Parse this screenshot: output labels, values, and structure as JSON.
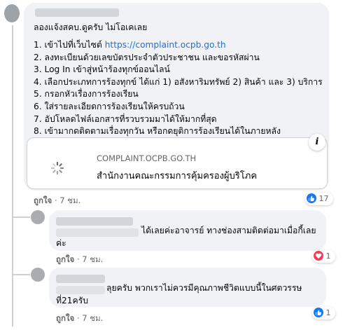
{
  "comment": {
    "author": "",
    "intro": "ลองแจ้งสคบ.ดูครับ ไม่โอเคเลย",
    "steps": [
      {
        "num": "1.",
        "text": "เข้าไปที่เว็บไซต์ ",
        "link": "https://complaint.ocpb.go.th"
      },
      {
        "num": "2.",
        "text": "ลงทะเบียนด้วยเลขบัตรประจำตัวประชาชน และขอรหัสผ่าน"
      },
      {
        "num": "3.",
        "text": "Log In เข้าสู่หน้าร้องทุกข์ออนไลน์"
      },
      {
        "num": "4.",
        "text": "เลือกประเภทการร้องทุกข์ ได้แก่ 1) อสังหาริมทรัพย์ 2) สินค้า และ 3) บริการ"
      },
      {
        "num": "5.",
        "text": "กรอกหัวเรื่องการร้องเรียน"
      },
      {
        "num": "6.",
        "text": "ใส่รายละเอียดการร้องเรียนให้ครบถ้วน"
      },
      {
        "num": "7.",
        "text": "อัปโหลดไฟล์เอกสารที่รวบรวมมาได้ให้มากที่สุด"
      },
      {
        "num": "8.",
        "text": "เข้ามากดติดตามเรื่องทุกวัน หรือกดยุติการร้องเรียนได้ในภายหลัง"
      }
    ],
    "card": {
      "domain": "COMPLAINT.OCPB.GO.TH",
      "title": "สำนักงานคณะกรรมการคุ้มครองผู้บริโภค",
      "info_label": "i"
    },
    "like_label": "ถูกใจ",
    "separator": "·",
    "time": "7 ชม.",
    "reaction_count": "17"
  },
  "replies": [
    {
      "text_line1": "ได้เลยค่ะอาจารย์ ทางช่องสามติดต่อมาเมื่อกี้เลย",
      "text_line2": "ค่ะ",
      "like_label": "ถูกใจ",
      "separator": "·",
      "time": "7 ชม.",
      "reaction_count": "1"
    },
    {
      "text_line1": "ลุยครับ พวกเราไม่ควรมีคุณภาพชีวิตแบบนี้ในศตวรรษ",
      "text_line2": "ที่21ครับ",
      "like_label": "ถูกใจ",
      "separator": "·",
      "time": "7 ชม.",
      "reaction_count": "1"
    }
  ],
  "colors": {
    "link": "#216fdb",
    "bubble": "#f0f2f5",
    "like_blue": "#1877f2",
    "love_red": "#f33e58"
  }
}
